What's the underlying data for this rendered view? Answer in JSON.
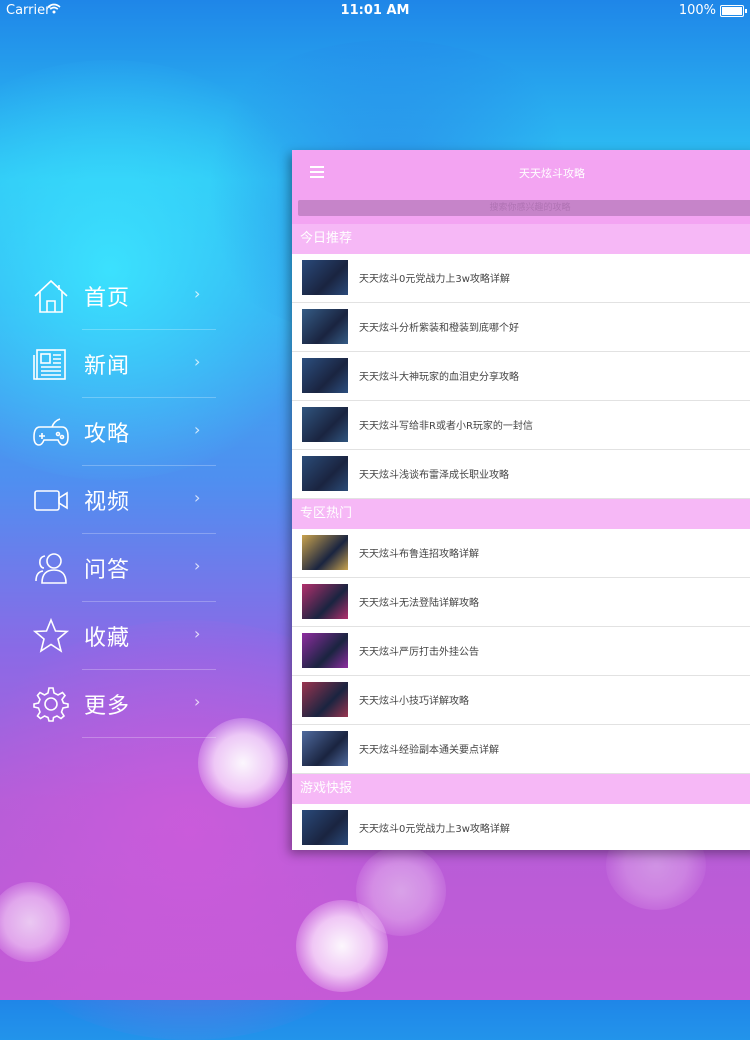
{
  "status_bar": {
    "carrier": "Carrier",
    "time": "11:01 AM",
    "battery": "100%"
  },
  "menu": {
    "chevron": "›",
    "items": [
      {
        "label": "首页",
        "icon": "home-icon"
      },
      {
        "label": "新闻",
        "icon": "newspaper-icon"
      },
      {
        "label": "攻略",
        "icon": "gamepad-icon"
      },
      {
        "label": "视频",
        "icon": "video-camera-icon"
      },
      {
        "label": "问答",
        "icon": "people-icon"
      },
      {
        "label": "收藏",
        "icon": "star-icon"
      },
      {
        "label": "更多",
        "icon": "gear-icon"
      }
    ]
  },
  "panel": {
    "title": "天天炫斗攻略",
    "search_placeholder": "搜索你感兴趣的攻略",
    "sections": [
      {
        "title": "今日推荐",
        "items": [
          {
            "title": "天天炫斗0元党战力上3w攻略详解",
            "thumb": "#2a4a7a"
          },
          {
            "title": "天天炫斗分析紫装和橙装到底哪个好",
            "thumb": "#355c86"
          },
          {
            "title": "天天炫斗大神玩家的血泪史分享攻略",
            "thumb": "#2c4f7f"
          },
          {
            "title": "天天炫斗写给非R或者小R玩家的一封信",
            "thumb": "#30557f"
          },
          {
            "title": "天天炫斗浅谈布雷泽成长职业攻略",
            "thumb": "#2b4c78"
          }
        ]
      },
      {
        "title": "专区热门",
        "items": [
          {
            "title": "天天炫斗布鲁连招攻略详解",
            "thumb": "#c9a34e"
          },
          {
            "title": "天天炫斗无法登陆详解攻略",
            "thumb": "#b2306d"
          },
          {
            "title": "天天炫斗严厉打击外挂公告",
            "thumb": "#8e2da0"
          },
          {
            "title": "天天炫斗小技巧详解攻略",
            "thumb": "#9a3550"
          },
          {
            "title": "天天炫斗经验副本通关要点详解",
            "thumb": "#4f6a9e"
          }
        ]
      },
      {
        "title": "游戏快报",
        "items": [
          {
            "title": "天天炫斗0元党战力上3w攻略详解",
            "thumb": "#2a4a7a"
          },
          {
            "title": "",
            "thumb": "#355c86"
          }
        ]
      }
    ]
  }
}
